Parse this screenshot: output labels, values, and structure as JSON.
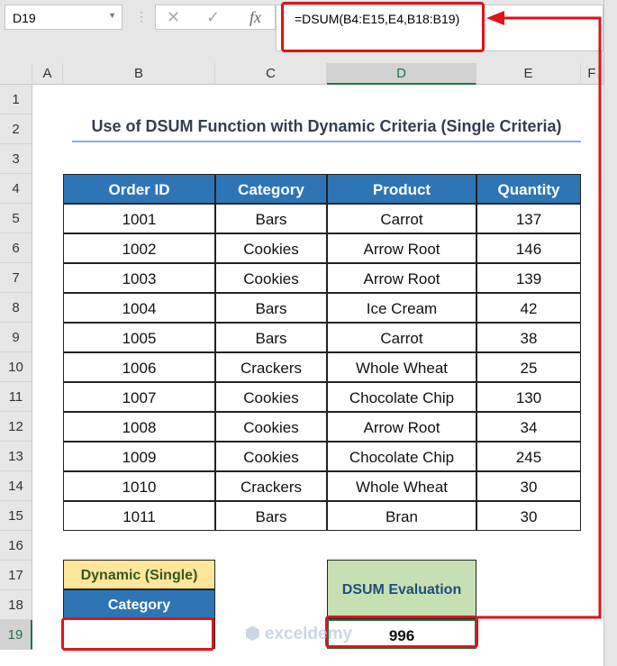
{
  "name_box": "D19",
  "formula_bar": {
    "cancel_icon": "✕",
    "enter_icon": "✓",
    "fx_label": "fx",
    "formula": "=DSUM(B4:E15,E4,B18:B19)"
  },
  "columns": [
    "A",
    "B",
    "C",
    "D",
    "E",
    "F"
  ],
  "rows": [
    "1",
    "2",
    "3",
    "4",
    "5",
    "6",
    "7",
    "8",
    "9",
    "10",
    "11",
    "12",
    "13",
    "14",
    "15",
    "16",
    "17",
    "18",
    "19"
  ],
  "title": "Use of DSUM Function with Dynamic Criteria (Single Criteria)",
  "table": {
    "headers": [
      "Order ID",
      "Category",
      "Product",
      "Quantity"
    ],
    "rows": [
      [
        "1001",
        "Bars",
        "Carrot",
        "137"
      ],
      [
        "1002",
        "Cookies",
        "Arrow Root",
        "146"
      ],
      [
        "1003",
        "Cookies",
        "Arrow Root",
        "139"
      ],
      [
        "1004",
        "Bars",
        "Ice Cream",
        "42"
      ],
      [
        "1005",
        "Bars",
        "Carrot",
        "38"
      ],
      [
        "1006",
        "Crackers",
        "Whole Wheat",
        "25"
      ],
      [
        "1007",
        "Cookies",
        "Chocolate Chip",
        "130"
      ],
      [
        "1008",
        "Cookies",
        "Arrow Root",
        "34"
      ],
      [
        "1009",
        "Cookies",
        "Chocolate Chip",
        "245"
      ],
      [
        "1010",
        "Crackers",
        "Whole Wheat",
        "30"
      ],
      [
        "1011",
        "Bars",
        "Bran",
        "30"
      ]
    ]
  },
  "criteria": {
    "title": "Dynamic (Single)",
    "header": "Category",
    "value": ""
  },
  "result": {
    "label": "DSUM Evaluation",
    "value": "996"
  },
  "watermark": "exceldemy EXCEL · DATA · BI",
  "colors": {
    "header_blue": "#2e75b6",
    "criteria_yellow": "#ffe699",
    "result_green": "#c6e0b4",
    "highlight_red": "#e0121a"
  }
}
